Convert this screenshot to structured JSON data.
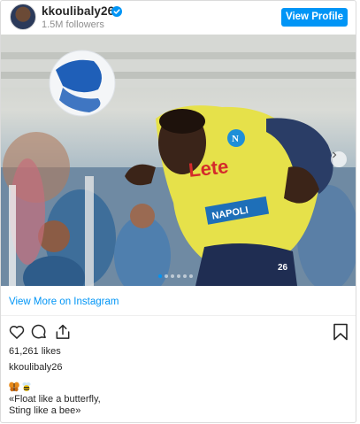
{
  "header": {
    "username": "kkoulibaly26",
    "followers": "1.5M followers",
    "view_profile_label": "View Profile"
  },
  "post": {
    "view_more_label": "View More on Instagram",
    "likes": "61,261 likes",
    "caption_username": "kkoulibaly26",
    "caption_emojis": [
      "butterfly",
      "bee"
    ],
    "caption_line1": "«Float like a butterfly,",
    "caption_line2": "Sting like a bee»",
    "carousel_total": 6,
    "carousel_active": 1
  },
  "colors": {
    "accent": "#0095f6",
    "text": "#262626",
    "muted": "#8e8e8e",
    "border": "#dbdbdb"
  },
  "icons": {
    "verified": "verified-badge-icon",
    "like": "heart-icon",
    "comment": "comment-icon",
    "share": "share-icon",
    "save": "bookmark-icon",
    "next": "chevron-right-icon"
  }
}
